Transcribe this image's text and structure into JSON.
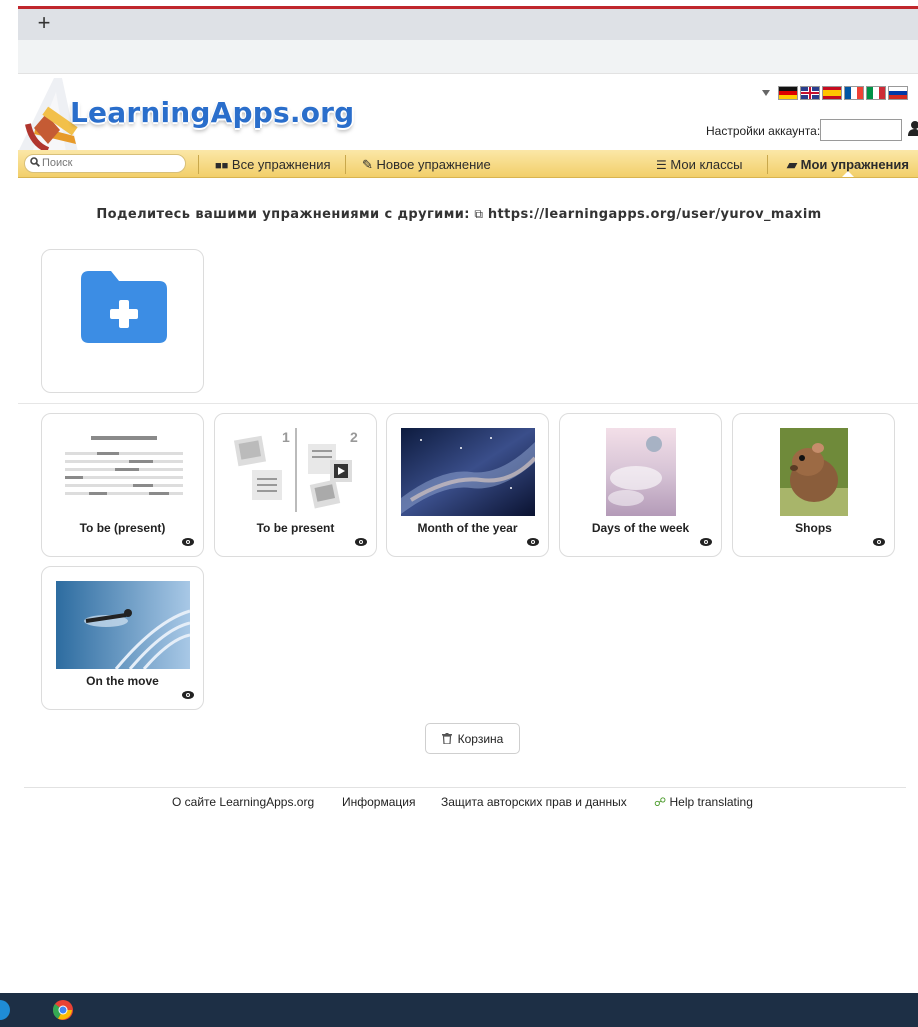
{
  "browser": {
    "new_tab": "+"
  },
  "header": {
    "logo": "LearningApps.org",
    "account_label": "Настройки аккаунта:",
    "account_value": ""
  },
  "nav": {
    "search_placeholder": "Поиск",
    "all_exercises": "Все упражнения",
    "new_exercise": "Новое упражнение",
    "my_classes": "Мои классы",
    "my_exercises": "Мои упражнения"
  },
  "share": {
    "text": "Поделитесь вашими упражнениями с другими:",
    "url": "https://learningapps.org/user/yurov_maxim"
  },
  "apps": [
    {
      "title": "To be (present)"
    },
    {
      "title": "To be present"
    },
    {
      "title": "Month of the year"
    },
    {
      "title": "Days of the week"
    },
    {
      "title": "Shops"
    },
    {
      "title": "On the move"
    }
  ],
  "trash_label": "Корзина",
  "footer": {
    "about": "О сайте LearningApps.org",
    "info": "Информация",
    "copyright": "Защита авторских прав и данных",
    "help": "Help translating"
  },
  "colors": {
    "accent": "#2a6ecb",
    "folder": "#3c8de4",
    "nav_bar": "#f2cf6a"
  }
}
